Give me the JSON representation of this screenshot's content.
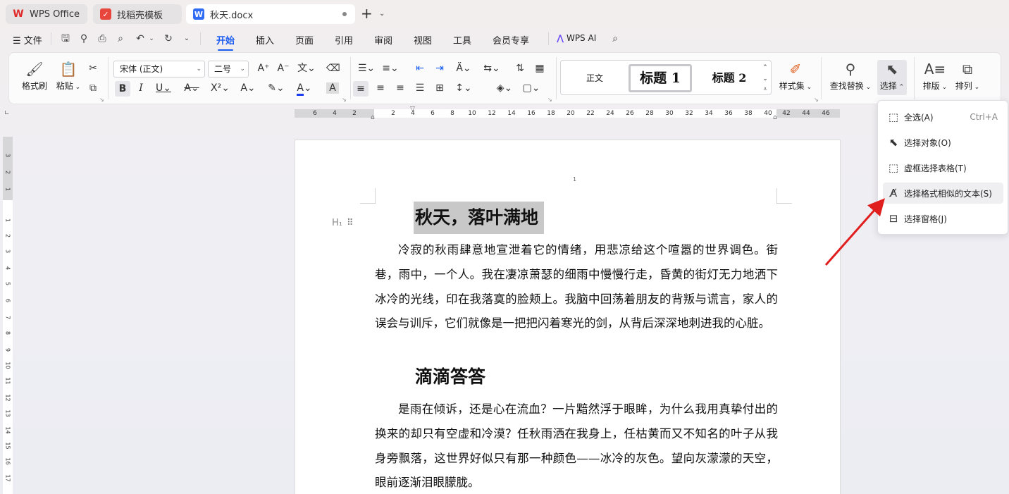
{
  "tabs": [
    {
      "label": "WPS Office",
      "logo": "W"
    },
    {
      "label": "找稻壳模板",
      "logo": "D"
    },
    {
      "label": "秋天.docx",
      "logo": "W"
    }
  ],
  "menu": {
    "file": "文件",
    "items": [
      "开始",
      "插入",
      "页面",
      "引用",
      "审阅",
      "视图",
      "工具",
      "会员专享"
    ],
    "wps_ai": "WPS AI"
  },
  "ribbon": {
    "format_painter": "格式刷",
    "paste": "粘贴",
    "font_name": "宋体 (正文)",
    "font_size": "二号",
    "styles": {
      "normal": "正文",
      "h1": "标题 1",
      "h2": "标题 2"
    },
    "style_set": "样式集",
    "find_replace": "查找替换",
    "select": "选择",
    "layout": "排版",
    "arrange": "排列"
  },
  "ruler": {
    "h_labels": [
      "6",
      "4",
      "2",
      "2",
      "4",
      "6",
      "8",
      "10",
      "12",
      "14",
      "16",
      "18",
      "20",
      "22",
      "24",
      "26",
      "28",
      "30",
      "32",
      "34",
      "36",
      "38",
      "40",
      "42",
      "44",
      "46"
    ],
    "v_labels": [
      "3",
      "2",
      "1",
      "1",
      "2",
      "3",
      "4",
      "5",
      "6",
      "7",
      "8",
      "9",
      "10",
      "11",
      "12",
      "13",
      "14",
      "15",
      "16",
      "17",
      "18"
    ]
  },
  "document": {
    "page_number": "1",
    "title1": "秋天，落叶满地",
    "para1": "冷寂的秋雨肆意地宣泄着它的情绪，用悲凉给这个喧嚣的世界调色。街巷，雨中，一个人。我在凄凉萧瑟的细雨中慢慢行走，昏黄的街灯无力地洒下冰冷的光线，印在我落寞的脸颊上。我脑中回荡着朋友的背叛与谎言，家人的误会与训斥，它们就像是一把把闪着寒光的剑，从背后深深地刺进我的心脏。",
    "title2": "滴滴答答",
    "para2": "是雨在倾诉，还是心在流血？一片黯然浮于眼眸，为什么我用真挚付出的换来的却只有空虚和冷漠？任秋雨洒在我身上，任枯黄而又不知名的叶子从我身旁飘落，这世界好似只有那一种颜色——冰冷的灰色。望向灰濛濛的天空，眼前逐渐泪眼朦胧。"
  },
  "select_menu": [
    {
      "label": "全选(A)",
      "shortcut": "Ctrl+A",
      "icon": "select-all-icon"
    },
    {
      "label": "选择对象(O)",
      "shortcut": "",
      "icon": "select-object-icon"
    },
    {
      "label": "虚框选择表格(T)",
      "shortcut": "",
      "icon": "dashed-box-icon"
    },
    {
      "label": "选择格式相似的文本(S)",
      "shortcut": "",
      "icon": "similar-format-icon"
    },
    {
      "label": "选择窗格(J)",
      "shortcut": "",
      "icon": "selection-pane-icon"
    }
  ],
  "colors": {
    "accent": "#1a5cf0",
    "arrow": "#e01e1e",
    "selection": "#c8c8c8"
  }
}
